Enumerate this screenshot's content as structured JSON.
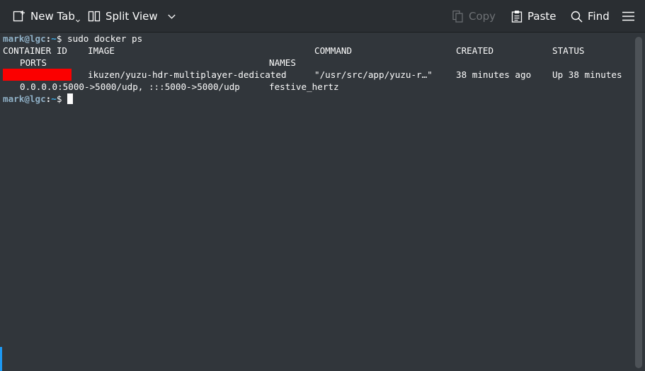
{
  "toolbar": {
    "new_tab": "New Tab",
    "split_view": "Split View",
    "copy": "Copy",
    "paste": "Paste",
    "find": "Find",
    "icons": [
      "new-tab-icon",
      "split-view-icon",
      "chevron-down-icon",
      "copy-icon",
      "paste-icon",
      "search-icon",
      "hamburger-menu-icon"
    ]
  },
  "terminal": {
    "prompt_user": "mark@lgc",
    "prompt_sep": ":",
    "prompt_path": "~",
    "prompt_dollar": "$",
    "command": " sudo docker ps",
    "headers": {
      "container_id": "CONTAINER ID",
      "image": "IMAGE",
      "command": "COMMAND",
      "created": "CREATED",
      "status": "STATUS",
      "ports": "PORTS",
      "names": "NAMES"
    },
    "row": {
      "image": "ikuzen/yuzu-hdr-multiplayer-dedicated",
      "command": "\"/usr/src/app/yuzu-r…\"",
      "created": "38 minutes ago",
      "status": "Up 38 minutes",
      "ports": "0.0.0.0:5000->5000/udp, :::5000->5000/udp",
      "names": "festive_hertz"
    }
  },
  "colors": {
    "background": "#31363b",
    "toolbar": "#2a2e32",
    "foreground": "#fcfcfc",
    "redaction": "#fb0000",
    "prompt_path": "#3daee9",
    "accent": "#1d99f3"
  }
}
